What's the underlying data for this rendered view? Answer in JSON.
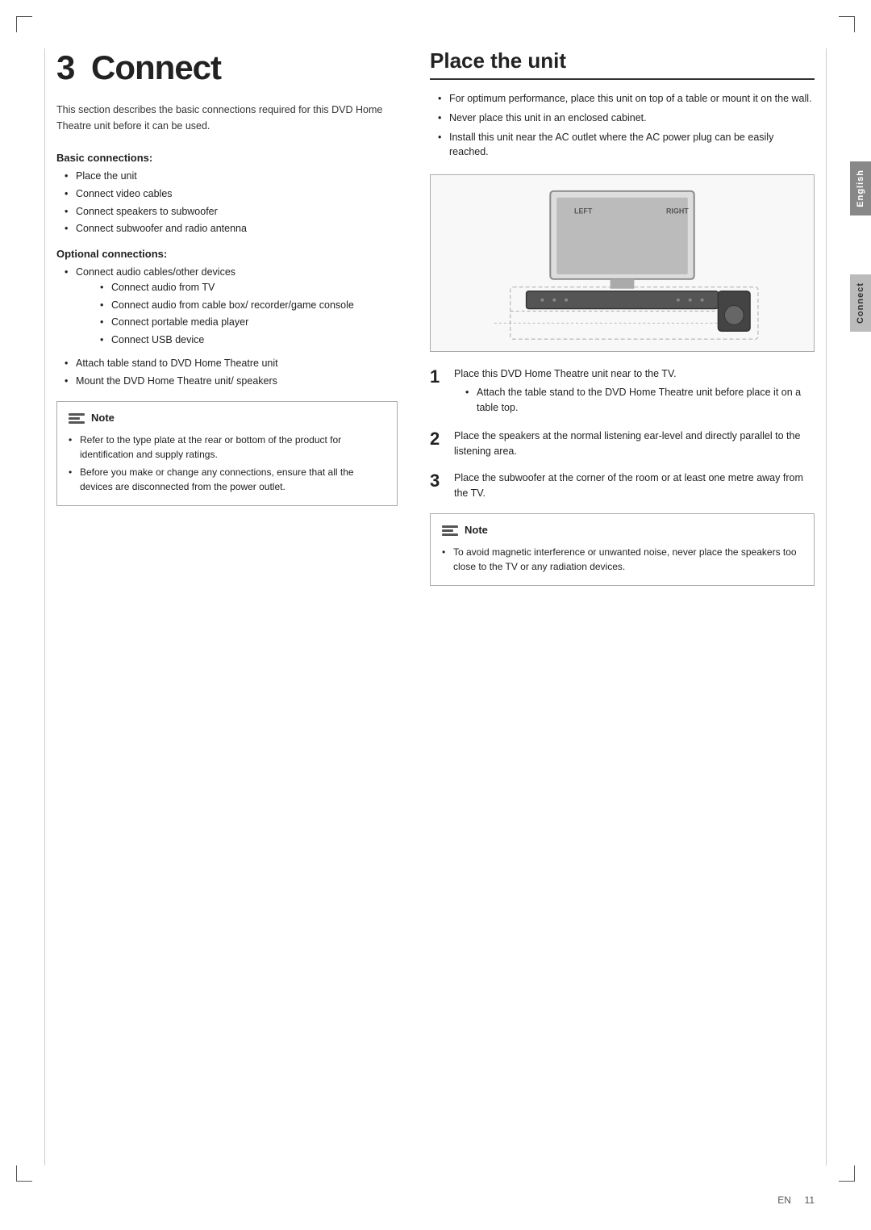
{
  "page": {
    "chapter_number": "3",
    "chapter_title": "Connect",
    "intro_text": "This section describes the basic connections required for this DVD Home Theatre unit before it can be used.",
    "basic_connections": {
      "heading": "Basic connections:",
      "items": [
        "Place the unit",
        "Connect video cables",
        "Connect speakers to subwoofer",
        "Connect subwoofer and radio antenna"
      ]
    },
    "optional_connections": {
      "heading": "Optional connections:",
      "top_item": "Connect audio cables/other devices",
      "sub_items": [
        "Connect audio from TV",
        "Connect audio from cable box/ recorder/game console",
        "Connect portable media player",
        "Connect USB device"
      ],
      "more_items": [
        "Attach table stand to DVD Home Theatre unit",
        "Mount the DVD Home Theatre unit/ speakers"
      ]
    },
    "note_left": {
      "label": "Note",
      "items": [
        "Refer to the type plate at the rear or bottom of the product for identification and supply ratings.",
        "Before you make or change any connections, ensure that all the devices are disconnected from the power outlet."
      ]
    },
    "right_section": {
      "title": "Place the unit",
      "bullets": [
        "For optimum performance, place this unit on top of a table or mount it on the wall.",
        "Never place this unit in an enclosed cabinet.",
        "Install this unit near the AC outlet where the AC power plug can be easily reached."
      ],
      "illustration_labels": {
        "left": "LEFT",
        "right": "RIGHT"
      },
      "steps": [
        {
          "number": "1",
          "text": "Place this DVD Home Theatre unit near to the TV.",
          "sub_items": [
            "Attach the table stand to the DVD Home Theatre unit before place it on a table top."
          ]
        },
        {
          "number": "2",
          "text": "Place the speakers at the normal listening ear-level and directly parallel to the listening area.",
          "sub_items": []
        },
        {
          "number": "3",
          "text": "Place the subwoofer at the corner of the room or at least one metre away from the TV.",
          "sub_items": []
        }
      ],
      "note_right": {
        "label": "Note",
        "items": [
          "To avoid magnetic interference or unwanted noise, never place the speakers too close to the TV or any radiation devices."
        ]
      }
    },
    "side_tabs": {
      "english": "English",
      "connect": "Connect"
    },
    "footer": {
      "lang": "EN",
      "page": "11"
    }
  }
}
